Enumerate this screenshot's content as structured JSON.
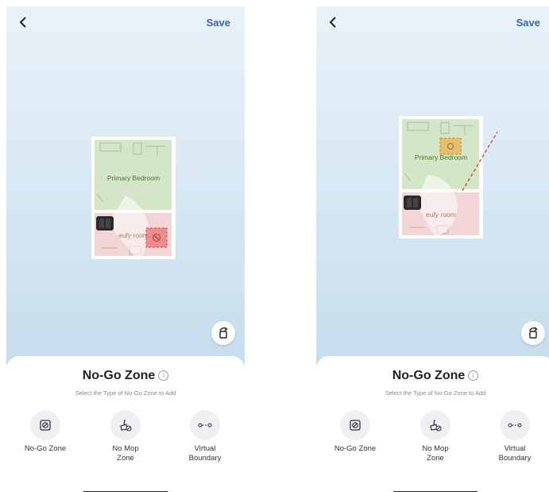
{
  "screens": [
    {
      "header": {
        "save_label": "Save"
      },
      "map": {
        "rooms": [
          {
            "name": "Primary Bedroom",
            "color": "#d3e6c8"
          },
          {
            "name": "eufy room",
            "color": "#f1d5d7"
          }
        ],
        "zones": [
          {
            "type": "no-go",
            "color": "#e85050"
          }
        ]
      },
      "sheet": {
        "title": "No-Go Zone",
        "subtitle": "Select the Type of No-Go Zone to Add",
        "options": [
          {
            "label": "No-Go Zone",
            "icon": "no-go-zone-icon"
          },
          {
            "label": "No Mop\nZone",
            "icon": "no-mop-zone-icon"
          },
          {
            "label": "Virtual\nBoundary",
            "icon": "virtual-boundary-icon"
          }
        ]
      }
    },
    {
      "header": {
        "save_label": "Save"
      },
      "map": {
        "rooms": [
          {
            "name": "Primary Bedroom",
            "color": "#d3e6c8"
          },
          {
            "name": "eufy room",
            "color": "#f1d5d7"
          }
        ],
        "zones": [
          {
            "type": "no-mop",
            "color": "#f0a030"
          },
          {
            "type": "virtual-boundary",
            "color": "#e03030"
          }
        ]
      },
      "sheet": {
        "title": "No-Go Zone",
        "subtitle": "Select the Type of No-Go Zone to Add",
        "options": [
          {
            "label": "No-Go Zone",
            "icon": "no-go-zone-icon"
          },
          {
            "label": "No Mop\nZone",
            "icon": "no-mop-zone-icon"
          },
          {
            "label": "Virtual\nBoundary",
            "icon": "virtual-boundary-icon"
          }
        ]
      }
    }
  ]
}
